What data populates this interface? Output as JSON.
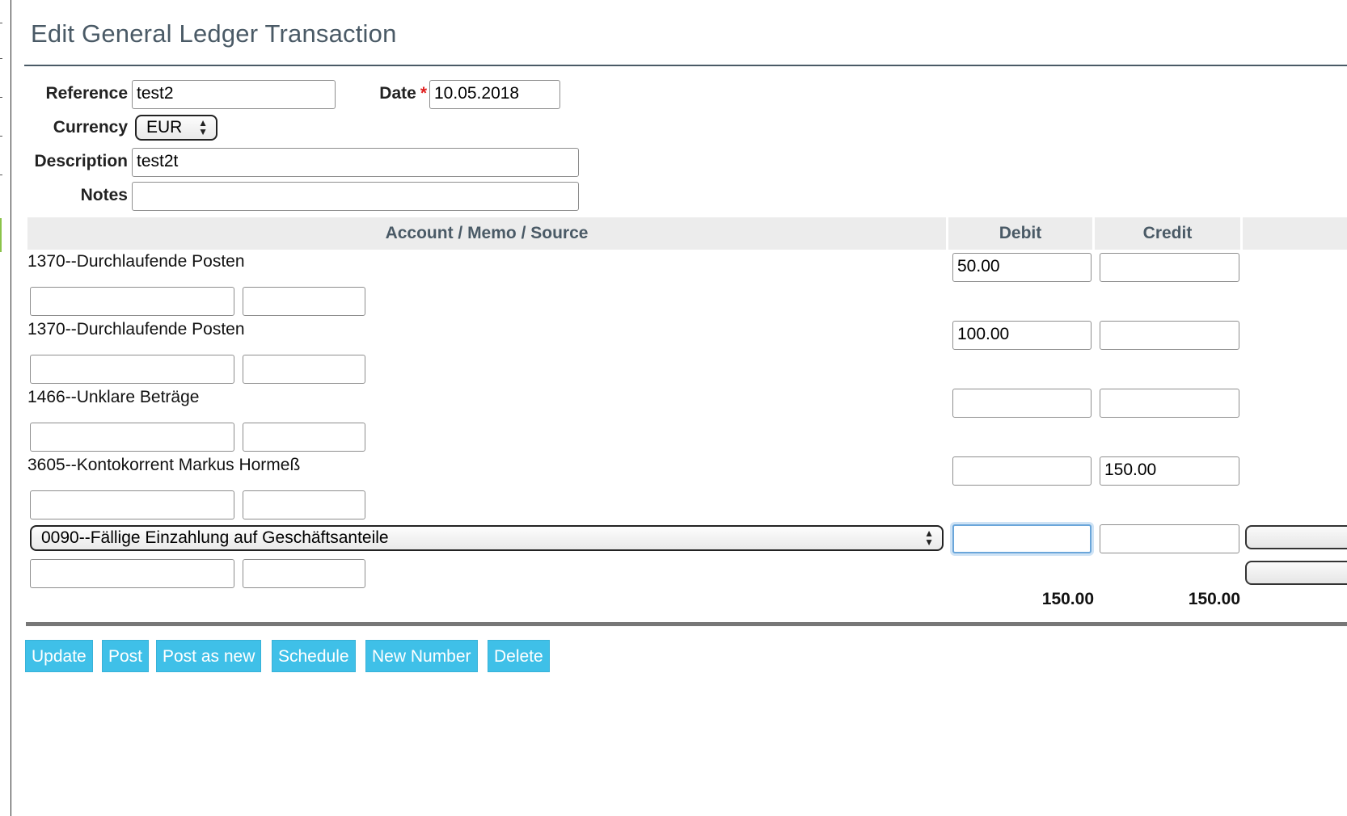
{
  "page": {
    "title": "Edit General Ledger Transaction"
  },
  "form": {
    "reference_label": "Reference",
    "reference_value": "test2",
    "date_label": "Date",
    "date_required": "*",
    "date_value": "10.05.2018",
    "currency_label": "Currency",
    "currency_value": "EUR",
    "description_label": "Description",
    "description_value": "test2t",
    "notes_label": "Notes",
    "notes_value": ""
  },
  "table": {
    "headers": {
      "account": "Account / Memo / Source",
      "debit": "Debit",
      "credit": "Credit"
    },
    "rows": [
      {
        "account": "1370--Durchlaufende Posten",
        "debit": "50.00",
        "credit": "",
        "memo": "",
        "source": ""
      },
      {
        "account": "1370--Durchlaufende Posten",
        "debit": "100.00",
        "credit": "",
        "memo": "",
        "source": ""
      },
      {
        "account": "1466--Unklare Beträge",
        "debit": "",
        "credit": "",
        "memo": "",
        "source": ""
      },
      {
        "account": "3605--Kontokorrent Markus Hormeß",
        "debit": "",
        "credit": "150.00",
        "memo": "",
        "source": ""
      }
    ],
    "new_row": {
      "account_select": "0090--Fällige Einzahlung auf Geschäftsanteile",
      "debit": "",
      "credit": "",
      "memo": "",
      "source": ""
    },
    "totals": {
      "debit": "150.00",
      "credit": "150.00"
    }
  },
  "buttons": {
    "update": "Update",
    "post": "Post",
    "post_as_new": "Post as new",
    "schedule": "Schedule",
    "new_number": "New Number",
    "delete": "Delete"
  },
  "icons": {
    "select_arrows": "up-down-arrows-icon"
  }
}
